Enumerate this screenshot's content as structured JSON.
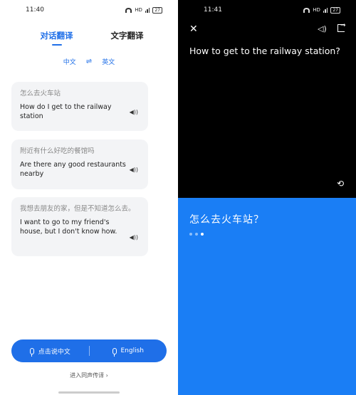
{
  "left": {
    "status": {
      "time": "11:40",
      "network": "HD",
      "battery": "27"
    },
    "tabs": [
      {
        "label": "对话翻译",
        "active": true
      },
      {
        "label": "文字翻译",
        "active": false
      }
    ],
    "languages": {
      "source": "中文",
      "target": "英文",
      "swap_icon": "swap-arrows-icon"
    },
    "cards": [
      {
        "source": "怎么去火车站",
        "translation": "How do I get to the railway station"
      },
      {
        "source": "附近有什么好吃的餐馆吗",
        "translation": "Are there any good restaurants nearby"
      },
      {
        "source": "我想去朋友的家，但是不知道怎么去。",
        "translation": "I want to go to my friend's house, but I don't know how."
      }
    ],
    "voicebar": {
      "chinese_label": "点击说中文",
      "english_label": "English"
    },
    "relay_label": "进入同声传译 ›"
  },
  "right": {
    "status": {
      "time": "11:41",
      "network": "HD",
      "battery": "27"
    },
    "question": "How to get to the railway station?",
    "answer": "怎么去火车站？",
    "page_dots": 3,
    "active_dot": 3
  },
  "colors": {
    "accent": "#1f6fe8",
    "blue_panel": "#1a7ef5",
    "card_bg": "#f3f4f6"
  }
}
